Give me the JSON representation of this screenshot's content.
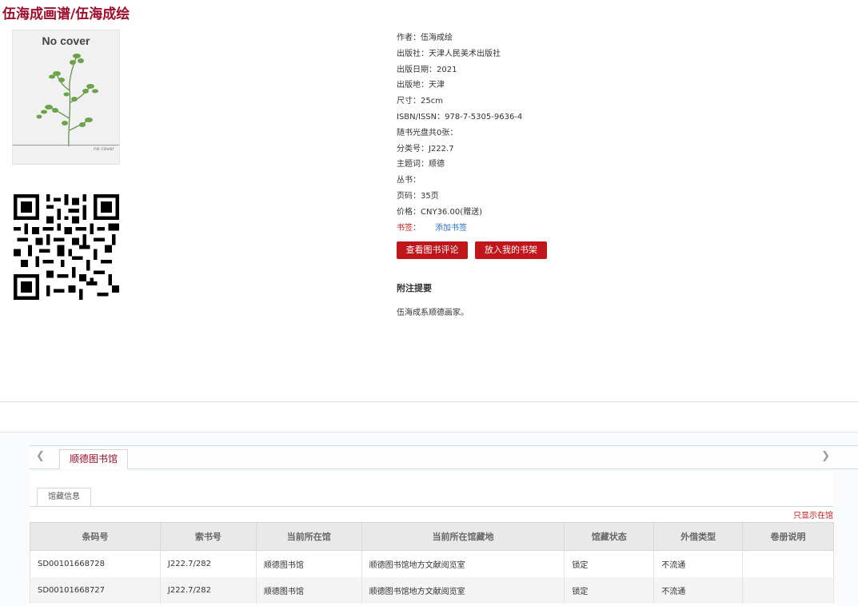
{
  "header": {
    "title_part1": "伍海成画谱",
    "separator": "/",
    "title_part2": "伍海成绘"
  },
  "cover": {
    "text_top": "No cover",
    "text_bottom": "no cover"
  },
  "meta": {
    "author": "作者：伍海成绘",
    "publisher": "出版社：天津人民美术出版社",
    "pub_date": "出版日期：2021",
    "pub_place": "出版地：天津",
    "size": "尺寸：25cm",
    "isbn": "ISBN/ISSN：978-7-5305-9636-4",
    "cd": "随书光盘共0张：",
    "class_no": "分类号：J222.7",
    "subject": "主题词：顺德",
    "series": "丛书：",
    "pages": "页码：35页",
    "price": "价格：CNY36.00(赠送)",
    "tags_label": "书签：",
    "tags_link": "添加书签"
  },
  "buttons": {
    "view_reviews": "查看图书评论",
    "add_shelf": "放入我的书架"
  },
  "notes": {
    "heading": "附注提要",
    "text": "伍海成系顺德画家。"
  },
  "library_tabs": {
    "active": "顺德图书馆",
    "prev_icon": "chevron-left-icon",
    "next_icon": "chevron-right-icon"
  },
  "holdings": {
    "subtab": "馆藏信息",
    "only_in_library": "只显示在馆",
    "columns": [
      "条码号",
      "索书号",
      "当前所在馆",
      "当前所在馆藏地",
      "馆藏状态",
      "外借类型",
      "卷册说明"
    ],
    "rows": [
      [
        "SD00101668728",
        "J222.7/282",
        "顺德图书馆",
        "顺德图书馆地方文献阅览室",
        "锁定",
        "不流通",
        ""
      ],
      [
        "SD00101668727",
        "J222.7/282",
        "顺德图书馆",
        "顺德图书馆地方文献阅览室",
        "锁定",
        "不流通",
        ""
      ]
    ]
  },
  "colors": {
    "brand_red": "#a00d2c",
    "button_red": "#c0151a",
    "link_blue": "#2a6fc9"
  }
}
